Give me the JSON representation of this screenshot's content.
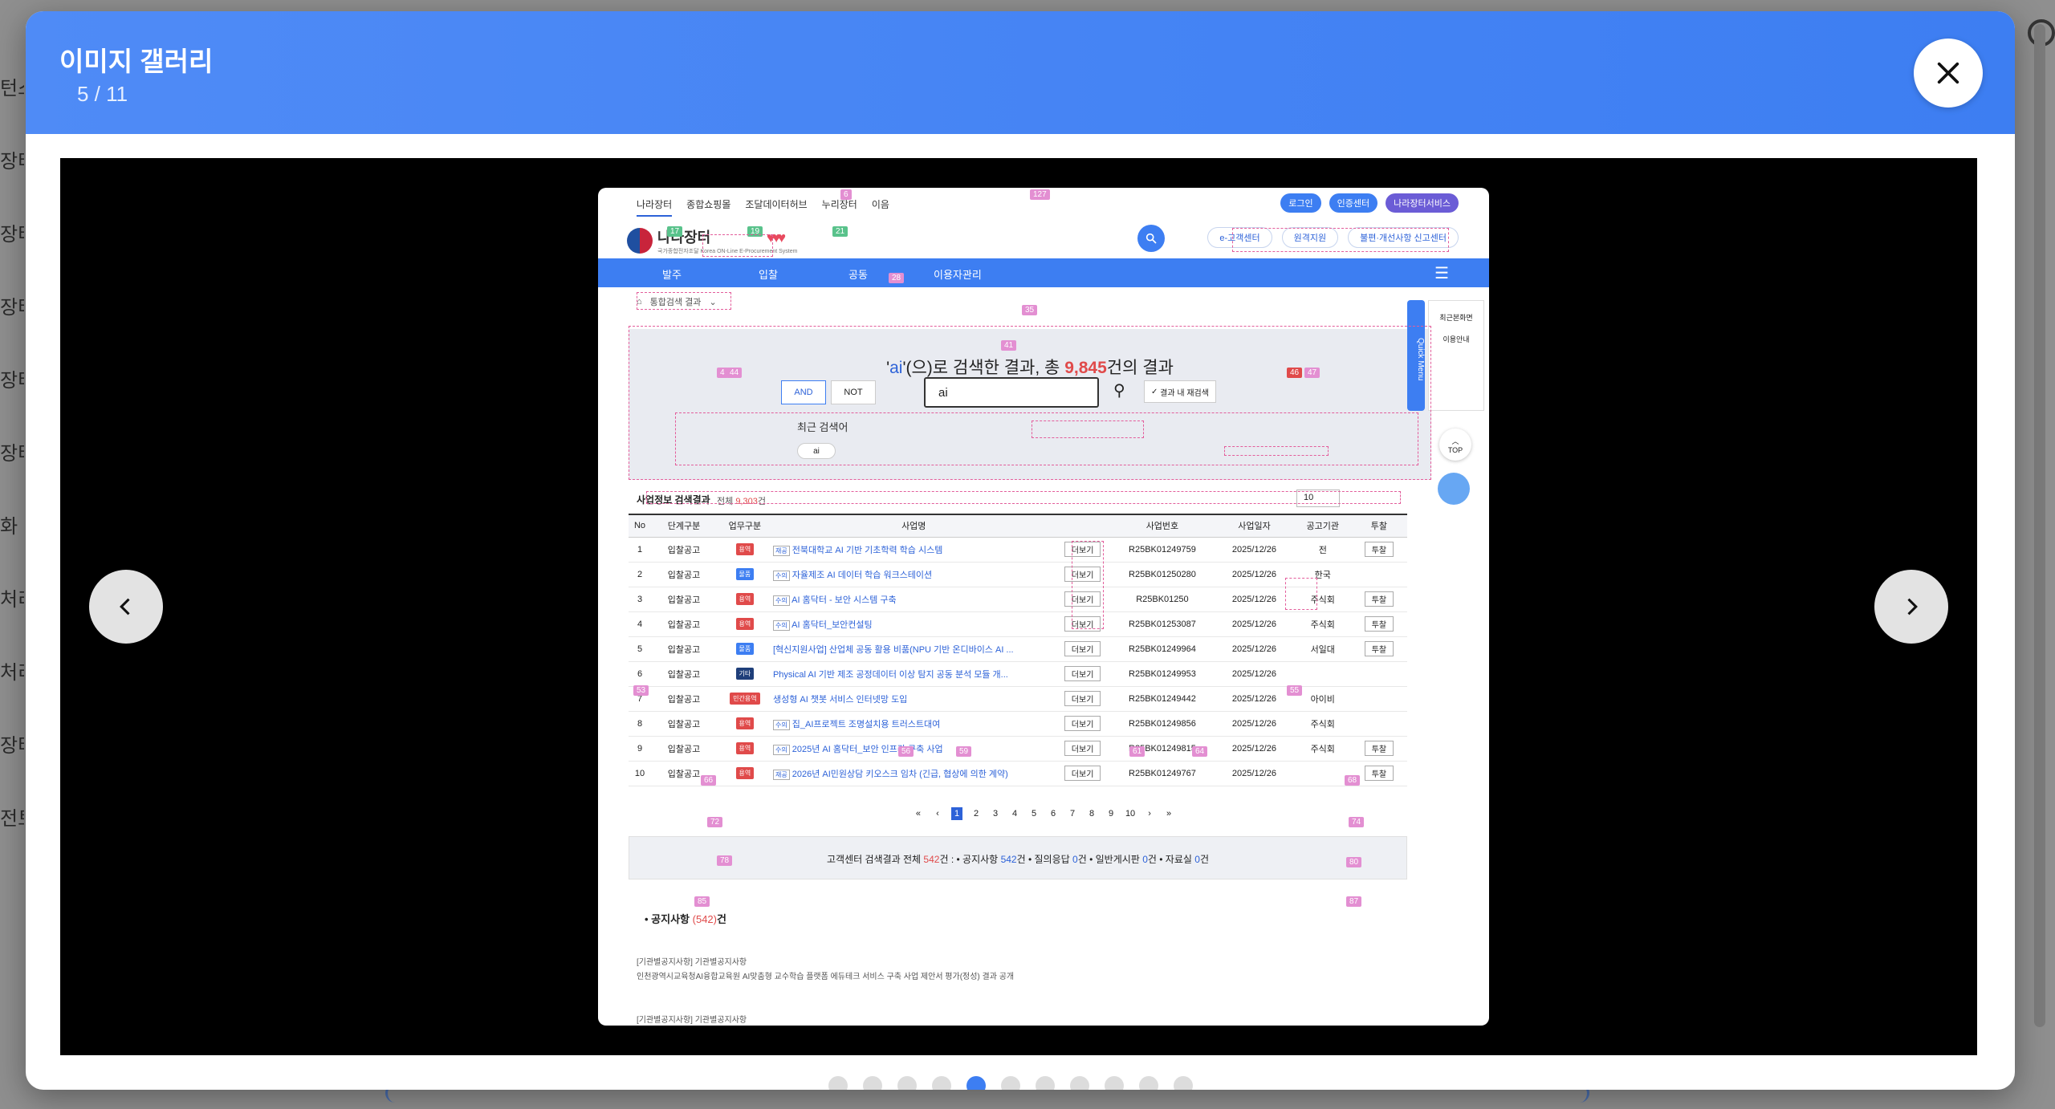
{
  "background": {
    "side_labels": [
      "턴스",
      "장터",
      "장터",
      "장터",
      "장터",
      "장터",
      "화 I",
      "처리",
      "처리",
      "장터",
      "전토"
    ]
  },
  "modal": {
    "title": "이미지 갤러리",
    "counter": "5 / 11",
    "close_icon": "close-icon",
    "prev_icon": "chevron-left-icon",
    "next_icon": "chevron-right-icon",
    "dots_total": 11,
    "dots_active_index": 4,
    "accent": "#3d7ef2"
  },
  "shot": {
    "top_links": [
      "나라장터",
      "종합쇼핑몰",
      "조달데이터허브",
      "누리장터",
      "이음"
    ],
    "top_pills": [
      {
        "label": "로그인",
        "color": "#3d7ef2"
      },
      {
        "label": "인증센터",
        "color": "#3d7ef2"
      },
      {
        "label": "나라장터서비스",
        "color": "#6b5cd6"
      }
    ],
    "logo_title": "나라장터",
    "logo_subtitle": "국가종합전자조달 Korea ON-Line E-Procurement System",
    "header_buttons": [
      "e-고객센터",
      "원격지원",
      "불편·개선사항 신고센터"
    ],
    "nav": [
      "발주",
      "입찰",
      "공동",
      "이용자관리"
    ],
    "breadcrumb": "통합검색 결과",
    "headline": {
      "pre": "'",
      "query": "ai",
      "mid": "'(으)로 검색한 결과, 총",
      "count": "9,845",
      "post": "건의 결과"
    },
    "op_and": "AND",
    "op_not": "NOT",
    "search_value": "ai",
    "rescan_label": "결과 내 재검색",
    "recent_label": "최근 검색어",
    "recent_chip": "ai",
    "quick_menu": "Quick Menu",
    "quick_items": [
      "최근본화면",
      "이용안내"
    ],
    "top_label": "TOP",
    "results_title": "사업정보 검색결과",
    "results_total_pre": "전체",
    "results_total": "9,303",
    "results_total_post": "건",
    "page_size": "10",
    "columns": [
      "No",
      "단계구분",
      "업무구분",
      "사업명",
      "",
      "사업번호",
      "사업일자",
      "공고기관",
      "투찰"
    ],
    "rows": [
      {
        "no": "1",
        "stage": "입찰공고",
        "kind": "용역",
        "kc": "red",
        "prefix": "재공",
        "name": "전북대학교 AI 기반 기초학력 학습 시스템",
        "num": "R25BK01249759",
        "date": "2025/12/26",
        "org": "전",
        "bid": "투찰"
      },
      {
        "no": "2",
        "stage": "입찰공고",
        "kind": "물품",
        "kc": "blue",
        "prefix": "수의",
        "name": "자율제조 AI 데이터 학습 워크스테이션",
        "num": "R25BK01250280",
        "date": "2025/12/26",
        "org": "한국",
        "bid": ""
      },
      {
        "no": "3",
        "stage": "입찰공고",
        "kind": "용역",
        "kc": "red",
        "prefix": "수의",
        "name": "AI 홈닥터 - 보안 시스템 구축",
        "num": "R25BK01250",
        "date": "2025/12/26",
        "org": "주식회",
        "bid": "투찰"
      },
      {
        "no": "4",
        "stage": "입찰공고",
        "kind": "용역",
        "kc": "red",
        "prefix": "수의",
        "name": "AI 홈닥터_보안컨설팅",
        "num": "R25BK01253087",
        "date": "2025/12/26",
        "org": "주식회",
        "bid": "투찰"
      },
      {
        "no": "5",
        "stage": "입찰공고",
        "kind": "물품",
        "kc": "blue",
        "prefix": "",
        "name": "[혁신지원사업] 산업체 공동 활용 비품(NPU 기반 온디바이스 AI ...",
        "num": "R25BK01249964",
        "date": "2025/12/26",
        "org": "서일대",
        "bid": "투찰"
      },
      {
        "no": "6",
        "stage": "입찰공고",
        "kind": "기타",
        "kc": "navy",
        "prefix": "",
        "name": "Physical AI 기반 제조 공정데이터 이상 탐지 공동 분석 모듈 개...",
        "num": "R25BK01249953",
        "date": "2025/12/26",
        "org": "",
        "bid": ""
      },
      {
        "no": "7",
        "stage": "입찰공고",
        "kind": "민간용역",
        "kc": "red",
        "prefix": "",
        "name": "생성형 AI 챗봇 서비스 인터넷망 도입",
        "num": "R25BK01249442",
        "date": "2025/12/26",
        "org": "아이비",
        "bid": ""
      },
      {
        "no": "8",
        "stage": "입찰공고",
        "kind": "용역",
        "kc": "red",
        "prefix": "수의",
        "name": "집_AI프로젝트 조명설치용 트러스트대여",
        "num": "R25BK01249856",
        "date": "2025/12/26",
        "org": "주식회",
        "bid": ""
      },
      {
        "no": "9",
        "stage": "입찰공고",
        "kind": "용역",
        "kc": "red",
        "prefix": "수의",
        "name": "2025년 AI 홈닥터_보안 인프라 구축 사업",
        "num": "R25BK01249815",
        "date": "2025/12/26",
        "org": "주식회",
        "bid": "투찰"
      },
      {
        "no": "10",
        "stage": "입찰공고",
        "kind": "용역",
        "kc": "red",
        "prefix": "재공",
        "name": "2026년 AI민원상담 키오스크 임차 (긴급, 협상에 의한 계약)",
        "num": "R25BK01249767",
        "date": "2025/12/26",
        "org": "",
        "bid": "투찰"
      }
    ],
    "more_label": "더보기",
    "pages": [
      "1",
      "2",
      "3",
      "4",
      "5",
      "6",
      "7",
      "8",
      "9",
      "10"
    ],
    "cs": {
      "pre": "고객센터 검색결과 전체",
      "total": "542",
      "total_unit": "건 :",
      "items": [
        {
          "label": "공지사항",
          "count": "542",
          "unit": "건"
        },
        {
          "label": "질의응답",
          "count": "0",
          "unit": "건"
        },
        {
          "label": "일반게시판",
          "count": "0",
          "unit": "건"
        },
        {
          "label": "자료실",
          "count": "0",
          "unit": "건"
        }
      ]
    },
    "notice_title": "공지사항",
    "notice_count": "(542)",
    "notice_unit": "건",
    "notice_lines": [
      "[기관별공지사항] 기관별공지사항",
      "인천광역시교육청AI융합교육원 AI맞춤형 교수학습 플랫폼 에듀테크 서비스 구축 사업 제안서 평가(정성) 결과 공개",
      "[기관별공지사항] 기관별공지사항"
    ],
    "tags": [
      "6",
      "127",
      "17",
      "19",
      "21",
      "28",
      "35",
      "41",
      "4",
      "44",
      "46",
      "47",
      "53",
      "55",
      "56",
      "59",
      "61",
      "64",
      "66",
      "68",
      "72",
      "74",
      "78",
      "80",
      "85",
      "87"
    ]
  }
}
